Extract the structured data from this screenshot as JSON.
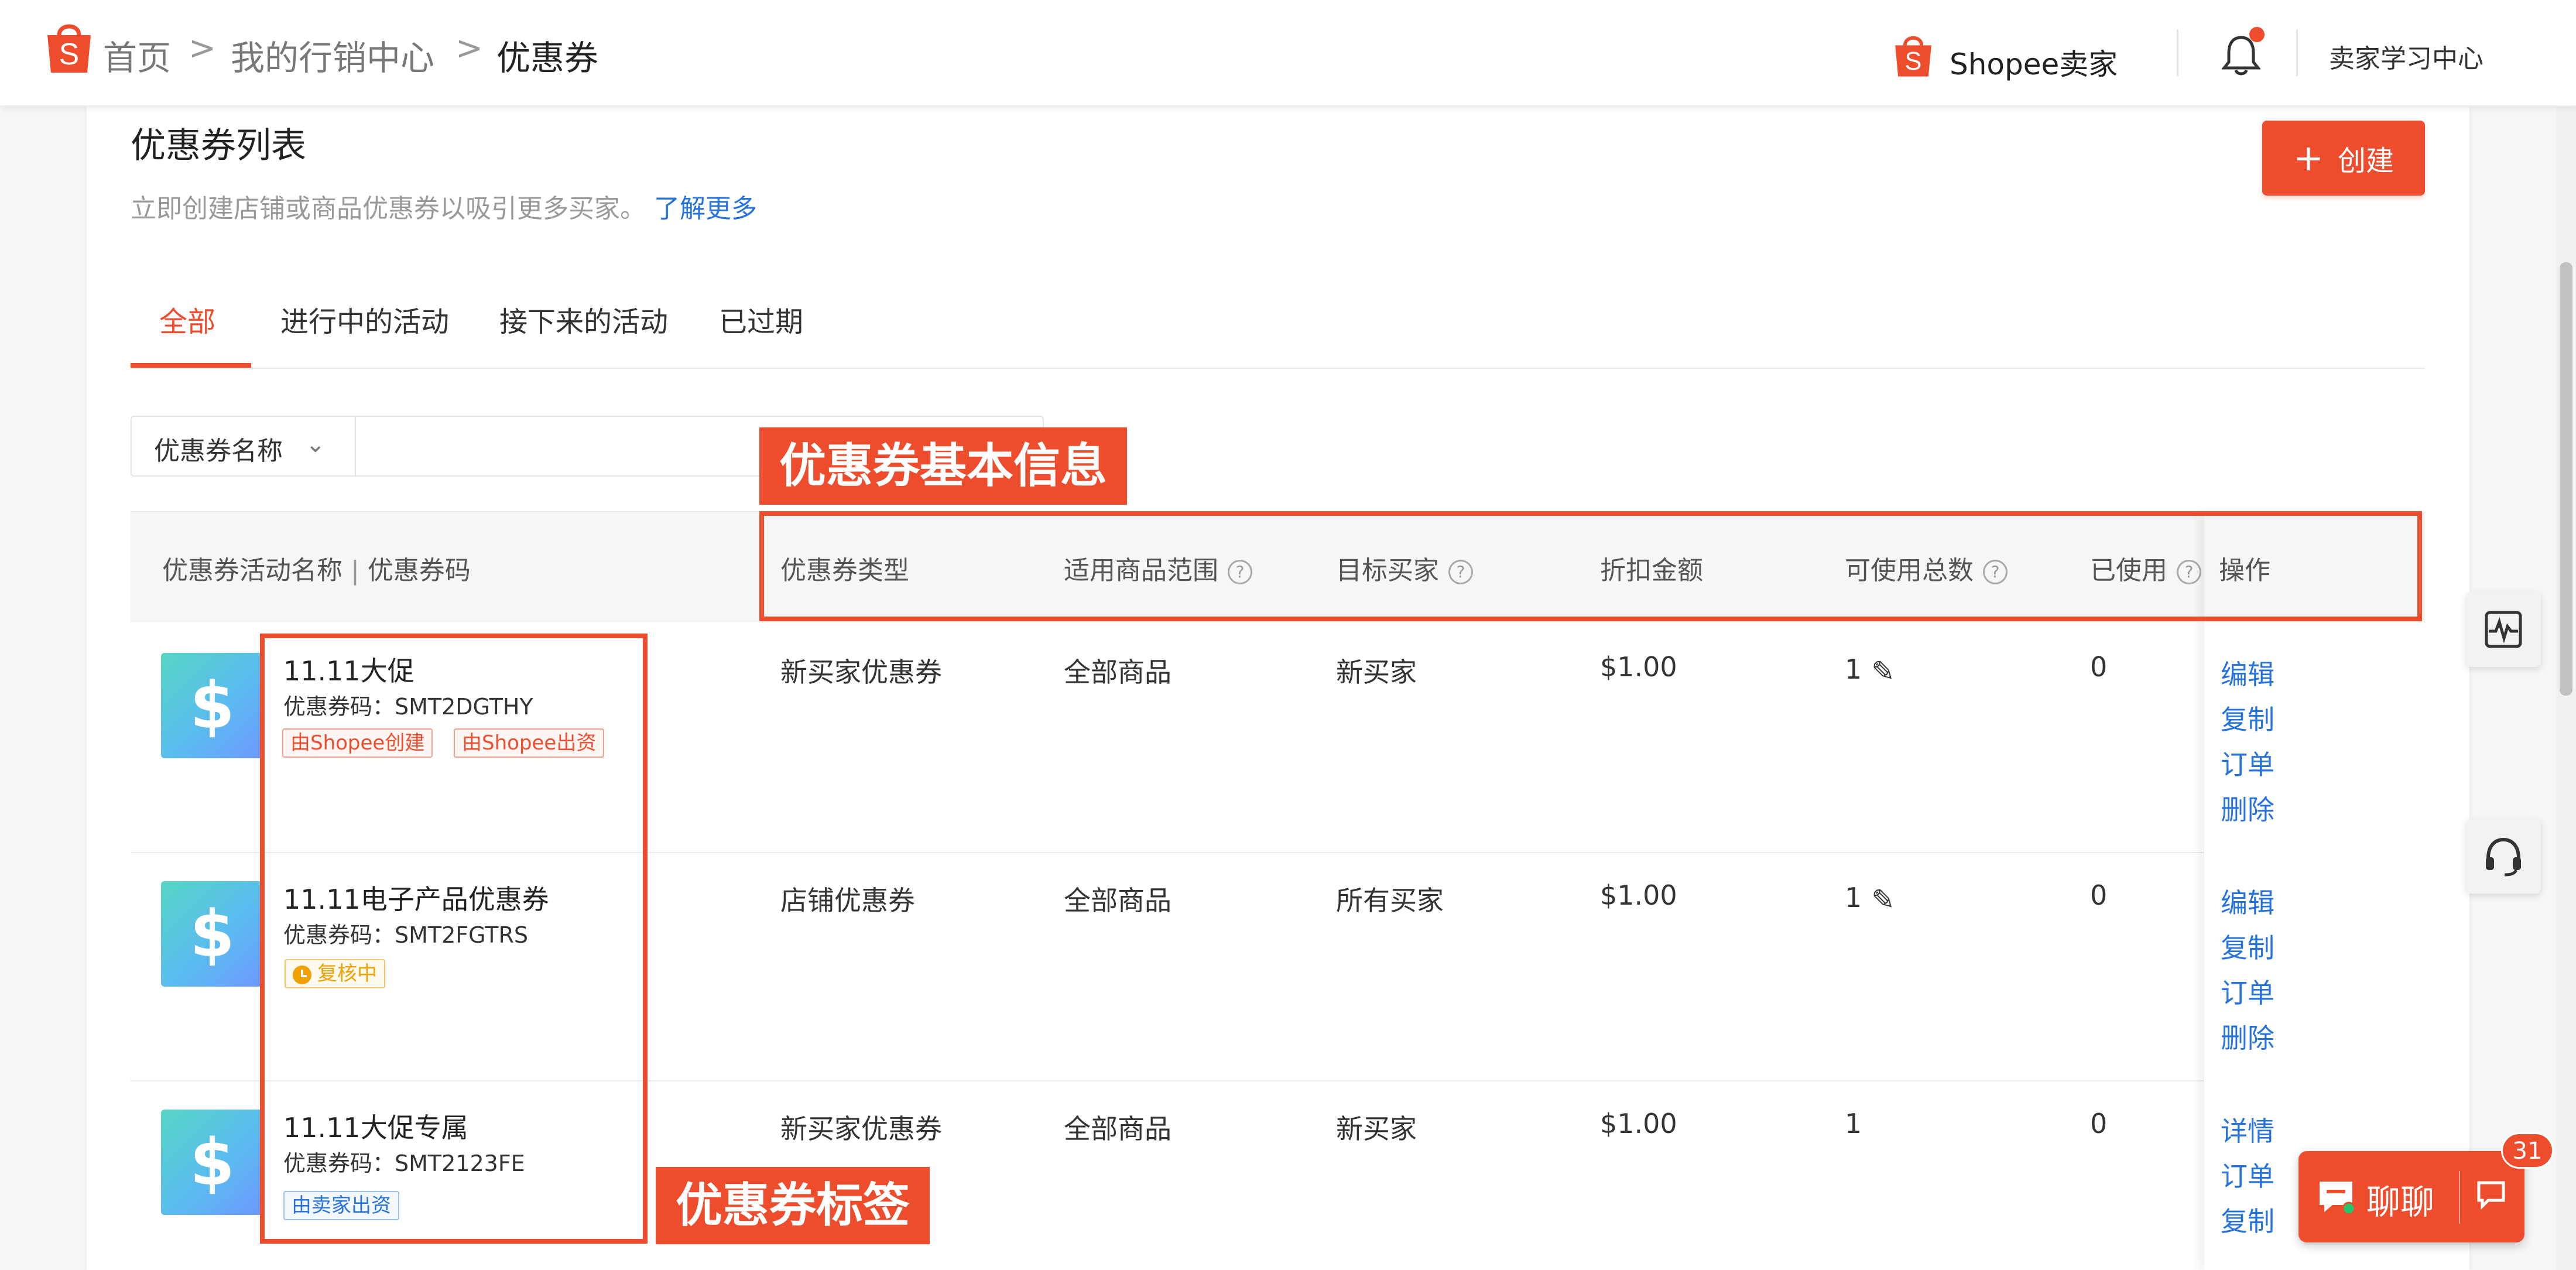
{
  "breadcrumb": {
    "home": "首页",
    "marketing": "我的行销中心",
    "current": "优惠券",
    "separator": ">"
  },
  "header": {
    "seller_brand": "Shopee卖家",
    "learning_center": "卖家学习中心"
  },
  "page": {
    "title": "优惠券列表",
    "subtitle": "立即创建店铺或商品优惠券以吸引更多买家。",
    "learn_more": "了解更多",
    "create_button": "创建"
  },
  "tabs": [
    {
      "label": "全部",
      "active": true
    },
    {
      "label": "进行中的活动",
      "active": false
    },
    {
      "label": "接下来的活动",
      "active": false
    },
    {
      "label": "已过期",
      "active": false
    }
  ],
  "filter": {
    "field": "优惠券名称"
  },
  "table": {
    "headers": {
      "name_a": "优惠券活动名称",
      "name_sep": "|",
      "name_b": "优惠券码",
      "type": "优惠券类型",
      "scope": "适用商品范围",
      "target": "目标买家",
      "discount": "折扣金额",
      "total": "可使用总数",
      "used": "已使用",
      "actions": "操作"
    },
    "help_glyph": "?",
    "rows": [
      {
        "name": "11.11大促",
        "code": "优惠券码：SMT2DGTHY",
        "tags": [
          "由Shopee创建",
          "由Shopee出资"
        ],
        "type": "新买家优惠券",
        "scope": "全部商品",
        "target": "新买家",
        "discount": "$1.00",
        "total": "1",
        "used": "0",
        "actions": [
          "编辑",
          "复制",
          "订单",
          "删除"
        ]
      },
      {
        "name": "11.11电子产品优惠券",
        "code": "优惠券码：SMT2FGTRS",
        "tags": [
          "复核中"
        ],
        "type": "店铺优惠券",
        "scope": "全部商品",
        "target": "所有买家",
        "discount": "$1.00",
        "total": "1",
        "used": "0",
        "actions": [
          "编辑",
          "复制",
          "订单",
          "删除"
        ]
      },
      {
        "name": "11.11大促专属",
        "code": "优惠券码：SMT2123FE",
        "tags": [
          "由卖家出资"
        ],
        "type": "新买家优惠券",
        "scope": "全部商品",
        "target": "新买家",
        "discount": "$1.00",
        "total": "1",
        "used": "0",
        "actions": [
          "详情",
          "订单",
          "复制"
        ]
      }
    ]
  },
  "annotations": {
    "basic_info": "优惠券基本信息",
    "tags": "优惠券标签"
  },
  "chat": {
    "label": "聊聊",
    "badge": "31"
  },
  "icons": {
    "logo": "shopee-bag-icon",
    "notification": "bell-icon",
    "coupon": "dollar-icon",
    "edit": "pencil-icon",
    "help": "question-circle-icon",
    "activity": "waveform-icon",
    "support": "headset-icon"
  },
  "colors": {
    "brand": "#ee4d2d",
    "link": "#2673dd",
    "pending": "#f2a000"
  }
}
